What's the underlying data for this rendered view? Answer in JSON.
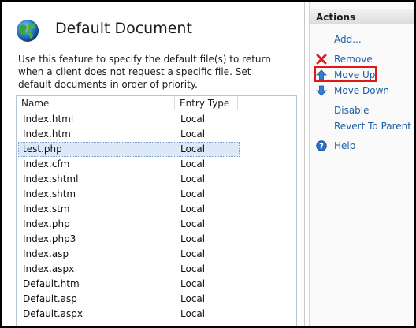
{
  "main": {
    "title": "Default Document",
    "description": "Use this feature to specify the default file(s) to return when a client does not request a specific file. Set default documents in order of priority.",
    "columns": [
      "Name",
      "Entry Type"
    ],
    "rows": [
      {
        "name": "Index.html",
        "type": "Local"
      },
      {
        "name": "Index.htm",
        "type": "Local"
      },
      {
        "name": "test.php",
        "type": "Local",
        "selected": true
      },
      {
        "name": "Index.cfm",
        "type": "Local"
      },
      {
        "name": "Index.shtml",
        "type": "Local"
      },
      {
        "name": "Index.shtm",
        "type": "Local"
      },
      {
        "name": "Index.stm",
        "type": "Local"
      },
      {
        "name": "Index.php",
        "type": "Local"
      },
      {
        "name": "Index.php3",
        "type": "Local"
      },
      {
        "name": "Index.asp",
        "type": "Local"
      },
      {
        "name": "Index.aspx",
        "type": "Local"
      },
      {
        "name": "Default.htm",
        "type": "Local"
      },
      {
        "name": "Default.asp",
        "type": "Local"
      },
      {
        "name": "Default.aspx",
        "type": "Local"
      }
    ]
  },
  "actions": {
    "header": "Actions",
    "add": "Add...",
    "remove": "Remove",
    "move_up": "Move Up",
    "move_down": "Move Down",
    "disable": "Disable",
    "revert": "Revert To Parent",
    "help": "Help"
  },
  "colors": {
    "link": "#1c5fa8",
    "highlight_box": "#e01818",
    "selection": "#dbe9f9"
  }
}
